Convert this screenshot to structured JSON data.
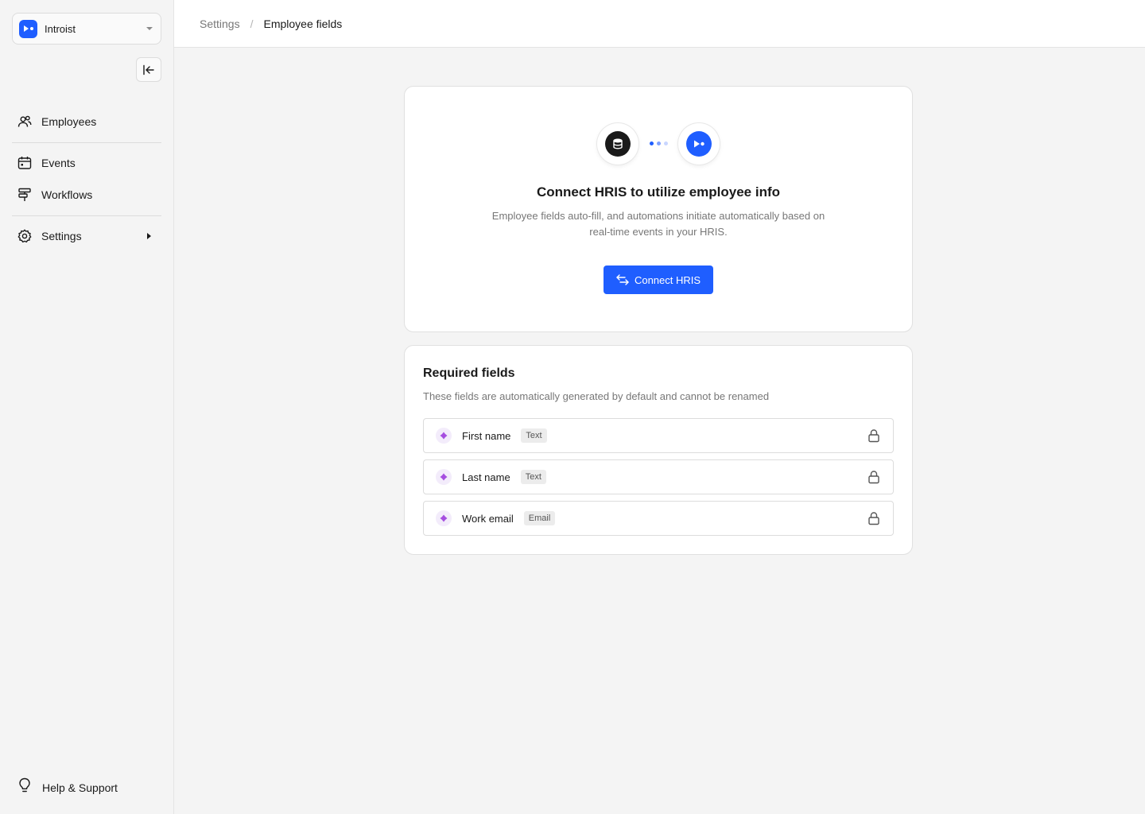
{
  "workspace": {
    "name": "Introist",
    "logo_icon": "introist-logo-icon",
    "brand_color": "#1f5eff"
  },
  "sidebar": {
    "items": [
      {
        "label": "Employees",
        "icon": "users-icon"
      },
      {
        "label": "Events",
        "icon": "calendar-icon"
      },
      {
        "label": "Workflows",
        "icon": "workflows-icon"
      },
      {
        "label": "Settings",
        "icon": "gear-icon"
      }
    ],
    "help_label": "Help & Support"
  },
  "breadcrumb": {
    "parent": "Settings",
    "separator": "/",
    "current": "Employee fields"
  },
  "hris": {
    "title": "Connect HRIS to utilize employee info",
    "description": "Employee fields auto-fill, and automations initiate automatically based on real-time events in your HRIS.",
    "button_label": "Connect HRIS",
    "left_icon": "database-icon",
    "right_icon": "introist-logo-icon"
  },
  "required_fields": {
    "title": "Required fields",
    "description": "These fields are automatically generated by default and cannot be renamed",
    "fields": [
      {
        "name": "First name",
        "type": "Text"
      },
      {
        "name": "Last name",
        "type": "Text"
      },
      {
        "name": "Work email",
        "type": "Email"
      }
    ]
  },
  "colors": {
    "accent": "#1f5eff",
    "field_icon": "#a64ee0",
    "dark": "#1a1a1a"
  }
}
